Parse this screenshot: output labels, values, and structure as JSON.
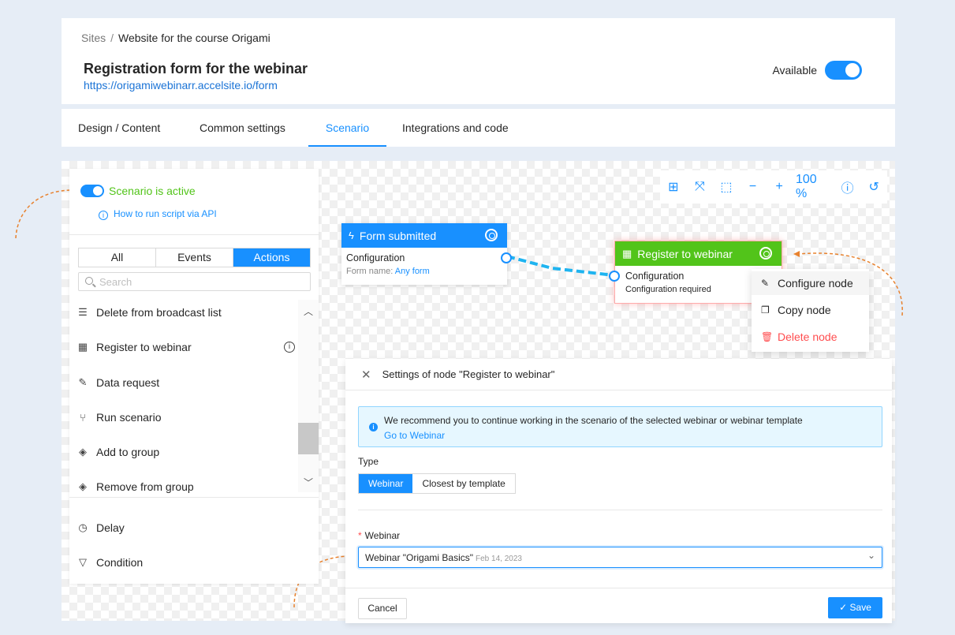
{
  "breadcrumb": {
    "root": "Sites",
    "separator": "/",
    "current": "Website for the course Origami"
  },
  "form": {
    "title": "Registration form for the webinar",
    "url": "https://origamiwebinarr.accelsite.io/form"
  },
  "availability": {
    "label": "Available",
    "enabled": true
  },
  "tabs": [
    {
      "label": "Design / Content",
      "active": false
    },
    {
      "label": "Common settings",
      "active": false
    },
    {
      "label": "Scenario",
      "active": true
    },
    {
      "label": "Integrations and code",
      "active": false
    }
  ],
  "left_panel": {
    "scenario_status": "Scenario is active",
    "api_link": "How to run script via API",
    "filters": [
      {
        "label": "All",
        "active": false
      },
      {
        "label": "Events",
        "active": false
      },
      {
        "label": "Actions",
        "active": true
      }
    ],
    "search_placeholder": "Search",
    "actions": [
      {
        "label": "Delete from broadcast list",
        "icon": "list-remove-icon"
      },
      {
        "label": "Register to webinar",
        "icon": "calendar-icon"
      },
      {
        "label": "Data request",
        "icon": "edit-icon"
      },
      {
        "label": "Run scenario",
        "icon": "branch-icon"
      },
      {
        "label": "Add to group",
        "icon": "tag-icon"
      },
      {
        "label": "Remove from group",
        "icon": "tag-icon"
      }
    ],
    "extra": [
      {
        "label": "Delay",
        "icon": "clock-icon"
      },
      {
        "label": "Condition",
        "icon": "filter-icon"
      }
    ]
  },
  "toolbar": {
    "zoom": "100 %"
  },
  "nodes": {
    "trigger": {
      "title": "Form submitted",
      "config_label": "Configuration",
      "form_name_label": "Form name:",
      "form_name_value": "Any form"
    },
    "action": {
      "title": "Register to webinar",
      "config_label": "Configuration",
      "status": "Configuration required"
    }
  },
  "context_menu": [
    {
      "label": "Configure node",
      "icon": "pencil-icon"
    },
    {
      "label": "Copy node",
      "icon": "copy-icon"
    },
    {
      "label": "Delete node",
      "icon": "trash-icon"
    }
  ],
  "settings": {
    "title": "Settings of node \"Register to webinar\"",
    "alert_text": "We recommend you to continue working in the scenario of the selected webinar or webinar template",
    "alert_link": "Go to Webinar",
    "type_label": "Type",
    "type_options": [
      {
        "label": "Webinar",
        "active": true
      },
      {
        "label": "Closest by template",
        "active": false
      }
    ],
    "webinar_label": "Webinar",
    "webinar_value": "Webinar \"Origami Basics\"",
    "webinar_date": "Feb 14, 2023",
    "cancel_label": "Cancel",
    "save_label": "Save"
  },
  "colors": {
    "accent": "#1890ff",
    "success": "#52c41a",
    "danger": "#ff4d4f",
    "annotation": "#e8822e"
  }
}
